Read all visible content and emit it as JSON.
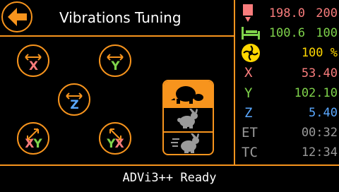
{
  "header": {
    "title": "Vibrations Tuning"
  },
  "axes_buttons": [
    {
      "label": "X",
      "color": "#f87c7c"
    },
    {
      "label": "Y",
      "color": "#7fd34b"
    },
    {
      "label": "Z",
      "color": "#5aa8ff"
    },
    {
      "label_a": "X",
      "label_b": "Y",
      "color_a": "#f87c7c",
      "color_b": "#7fd34b"
    },
    {
      "label_a": "Y",
      "label_b": "X",
      "color_a": "#7fd34b",
      "color_b": "#f87c7c"
    }
  ],
  "status": {
    "hotend": {
      "current": "198.0",
      "target": "200"
    },
    "bed": {
      "current": "100.6",
      "target": "100"
    },
    "fan": {
      "value": "100 %"
    },
    "x": {
      "label": "X",
      "value": "53.40"
    },
    "y": {
      "label": "Y",
      "value": "102.10"
    },
    "z": {
      "label": "Z",
      "value": "5.40"
    },
    "et": {
      "label": "ET",
      "value": "00:32"
    },
    "tc": {
      "label": "TC",
      "value": "12:34"
    }
  },
  "footer": {
    "status_message": "ADVi3++ Ready"
  },
  "colors": {
    "accent": "#f7941d",
    "hotend": "#f87c7c",
    "bed": "#7fd34b",
    "fan": "#ffd700",
    "x": "#f87c7c",
    "y": "#7fd34b",
    "z": "#5aa8ff",
    "time": "#9a9a9a"
  }
}
